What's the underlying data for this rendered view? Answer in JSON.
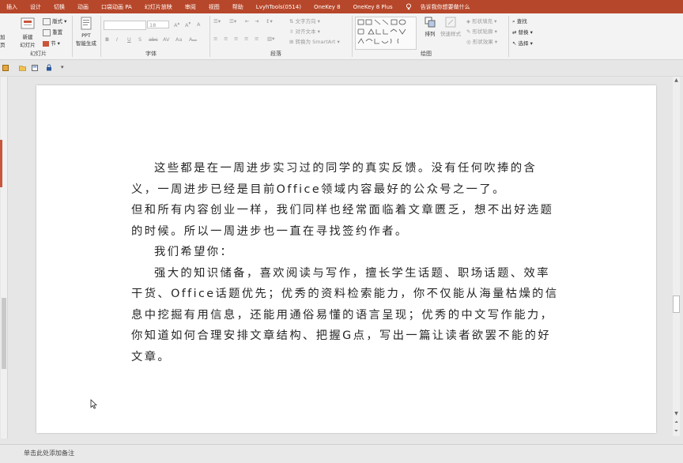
{
  "tabs": [
    "插入",
    "设计",
    "切换",
    "动画",
    "口袋动画 PA",
    "幻灯片放映",
    "审阅",
    "视图",
    "帮助",
    "LvyhTools(0514)",
    "OneKey 8",
    "OneKey 8 Plus"
  ],
  "tell_me": "告诉我你想要做什么",
  "ribbon": {
    "slides_group": {
      "label": "幻灯片",
      "add_partial": "加",
      "page_partial": "页",
      "new_slide": "新建",
      "new_slide_2": "幻灯片",
      "layout": "版式",
      "reset": "重置",
      "section": "节"
    },
    "ppt_group": {
      "line1": "PPT",
      "line2": "智能生成"
    },
    "font_group": {
      "label": "字体",
      "font_size": "18"
    },
    "paragraph_group": {
      "label": "段落",
      "text_direction": "文字方向",
      "align_text": "对齐文本",
      "smartart": "转换为 SmartArt"
    },
    "drawing_group": {
      "label": "绘图",
      "arrange": "排列",
      "quick_styles": "快速样式",
      "shape_fill": "形状填充",
      "shape_outline": "形状轮廓",
      "shape_effects": "形状效果"
    },
    "editing_group": {
      "find": "查找",
      "replace": "替换",
      "select": "选择"
    }
  },
  "slide": {
    "paragraphs": [
      "这些都是在一周进步实习过的同学的真实反馈。没有任何吹捧的含义，一周进步已经是目前Office领域内容最好的公众号之一了。",
      "但和所有内容创业一样，我们同样也经常面临着文章匮乏，想不出好选题的时候。所以一周进步也一直在寻找签约作者。",
      "我们希望你：",
      "强大的知识储备，喜欢阅读与写作，擅长学生话题、职场话题、效率干货、Office话题优先；优秀的资料检索能力，你不仅能从海量枯燥的信息中挖掘有用信息，还能用通俗易懂的语言呈现；优秀的中文写作能力，你知道如何合理安排文章结构、把握G点，写出一篇让读者欲罢不能的好文章。"
    ]
  },
  "notes_placeholder": "单击此处添加备注",
  "colors": {
    "accent": "#b7472a",
    "ribbon_bg": "#f3f3f3",
    "canvas_bg": "#e6e6e6"
  }
}
